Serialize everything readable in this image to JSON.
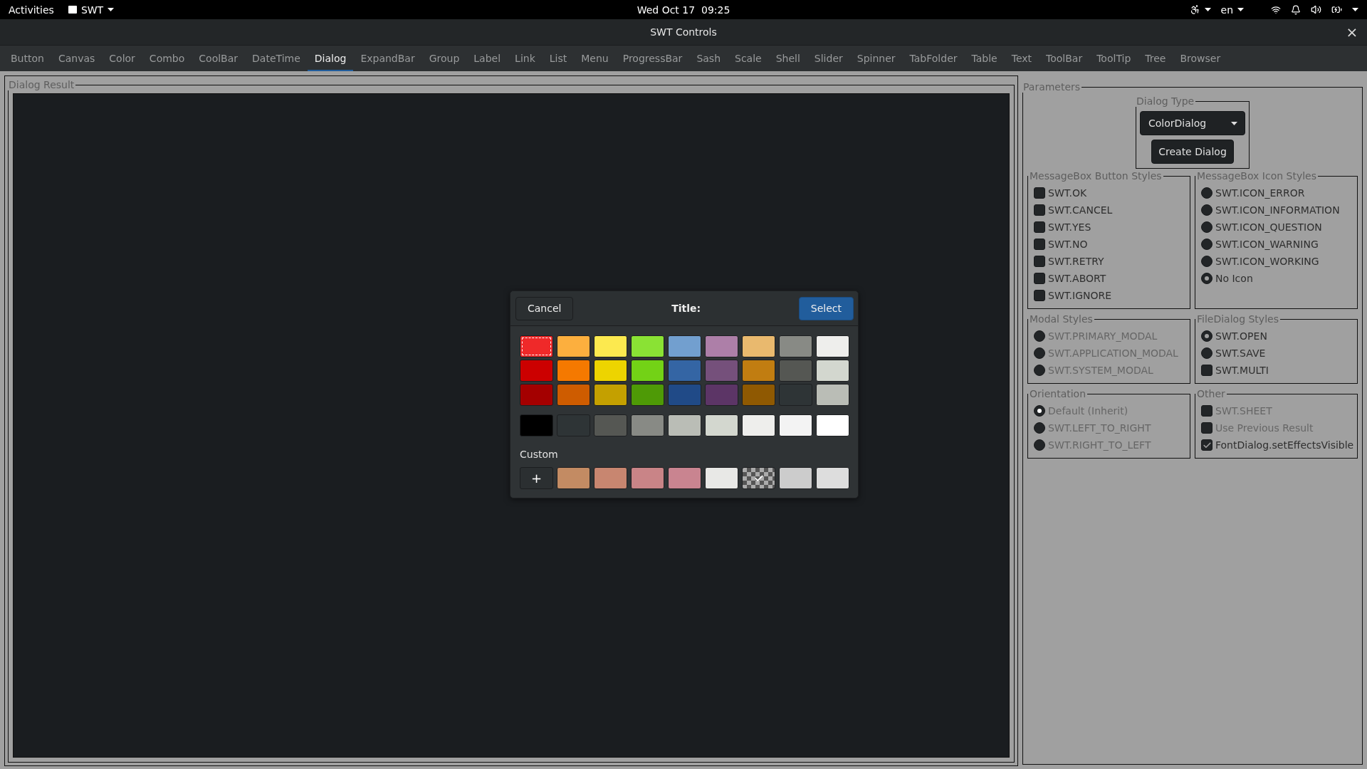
{
  "top_bar": {
    "activities": "Activities",
    "app_menu": "SWT",
    "clock": "Wed Oct 17  09:25",
    "language": "en"
  },
  "window": {
    "title": "SWT Controls",
    "close": "×"
  },
  "tabs": [
    {
      "label": "Button",
      "selected": false
    },
    {
      "label": "Canvas",
      "selected": false
    },
    {
      "label": "Color",
      "selected": false
    },
    {
      "label": "Combo",
      "selected": false
    },
    {
      "label": "CoolBar",
      "selected": false
    },
    {
      "label": "DateTime",
      "selected": false
    },
    {
      "label": "Dialog",
      "selected": true
    },
    {
      "label": "ExpandBar",
      "selected": false
    },
    {
      "label": "Group",
      "selected": false
    },
    {
      "label": "Label",
      "selected": false
    },
    {
      "label": "Link",
      "selected": false
    },
    {
      "label": "List",
      "selected": false
    },
    {
      "label": "Menu",
      "selected": false
    },
    {
      "label": "ProgressBar",
      "selected": false
    },
    {
      "label": "Sash",
      "selected": false
    },
    {
      "label": "Scale",
      "selected": false
    },
    {
      "label": "Shell",
      "selected": false
    },
    {
      "label": "Slider",
      "selected": false
    },
    {
      "label": "Spinner",
      "selected": false
    },
    {
      "label": "TabFolder",
      "selected": false
    },
    {
      "label": "Table",
      "selected": false
    },
    {
      "label": "Text",
      "selected": false
    },
    {
      "label": "ToolBar",
      "selected": false
    },
    {
      "label": "ToolTip",
      "selected": false
    },
    {
      "label": "Tree",
      "selected": false
    },
    {
      "label": "Browser",
      "selected": false
    }
  ],
  "result_group": {
    "legend": "Dialog Result"
  },
  "parameters": {
    "legend": "Parameters",
    "dialog_type": {
      "legend": "Dialog Type",
      "value": "ColorDialog",
      "button": "Create Dialog"
    },
    "groups": [
      {
        "legend": "MessageBox Button Styles",
        "items": [
          {
            "label": "SWT.OK",
            "kind": "checkbox",
            "checked": false,
            "disabled": false
          },
          {
            "label": "SWT.CANCEL",
            "kind": "checkbox",
            "checked": false,
            "disabled": false
          },
          {
            "label": "SWT.YES",
            "kind": "checkbox",
            "checked": false,
            "disabled": false
          },
          {
            "label": "SWT.NO",
            "kind": "checkbox",
            "checked": false,
            "disabled": false
          },
          {
            "label": "SWT.RETRY",
            "kind": "checkbox",
            "checked": false,
            "disabled": false
          },
          {
            "label": "SWT.ABORT",
            "kind": "checkbox",
            "checked": false,
            "disabled": false
          },
          {
            "label": "SWT.IGNORE",
            "kind": "checkbox",
            "checked": false,
            "disabled": false
          }
        ]
      },
      {
        "legend": "MessageBox Icon Styles",
        "items": [
          {
            "label": "SWT.ICON_ERROR",
            "kind": "radio",
            "checked": false,
            "disabled": false
          },
          {
            "label": "SWT.ICON_INFORMATION",
            "kind": "radio",
            "checked": false,
            "disabled": false
          },
          {
            "label": "SWT.ICON_QUESTION",
            "kind": "radio",
            "checked": false,
            "disabled": false
          },
          {
            "label": "SWT.ICON_WARNING",
            "kind": "radio",
            "checked": false,
            "disabled": false
          },
          {
            "label": "SWT.ICON_WORKING",
            "kind": "radio",
            "checked": false,
            "disabled": false
          },
          {
            "label": "No Icon",
            "kind": "radio",
            "checked": true,
            "disabled": false
          }
        ]
      },
      {
        "legend": "Modal Styles",
        "items": [
          {
            "label": "SWT.PRIMARY_MODAL",
            "kind": "radio",
            "checked": false,
            "disabled": true
          },
          {
            "label": "SWT.APPLICATION_MODAL",
            "kind": "radio",
            "checked": false,
            "disabled": true
          },
          {
            "label": "SWT.SYSTEM_MODAL",
            "kind": "radio",
            "checked": false,
            "disabled": true
          }
        ]
      },
      {
        "legend": "FileDialog Styles",
        "items": [
          {
            "label": "SWT.OPEN",
            "kind": "radio",
            "checked": true,
            "disabled": false
          },
          {
            "label": "SWT.SAVE",
            "kind": "radio",
            "checked": false,
            "disabled": false
          },
          {
            "label": "SWT.MULTI",
            "kind": "checkbox",
            "checked": false,
            "disabled": false
          }
        ]
      },
      {
        "legend": "Orientation",
        "items": [
          {
            "label": "Default (Inherit)",
            "kind": "radio",
            "checked": true,
            "disabled": true
          },
          {
            "label": "SWT.LEFT_TO_RIGHT",
            "kind": "radio",
            "checked": false,
            "disabled": true
          },
          {
            "label": "SWT.RIGHT_TO_LEFT",
            "kind": "radio",
            "checked": false,
            "disabled": true
          }
        ]
      },
      {
        "legend": "Other",
        "items": [
          {
            "label": "SWT.SHEET",
            "kind": "checkbox",
            "checked": false,
            "disabled": true
          },
          {
            "label": "Use Previous Result",
            "kind": "checkbox",
            "checked": false,
            "disabled": true
          },
          {
            "label": "FontDialog.setEffectsVisible",
            "kind": "checkbox",
            "checked": true,
            "disabled": false
          }
        ]
      }
    ]
  },
  "color_dialog": {
    "cancel": "Cancel",
    "title": "Title:",
    "select": "Select",
    "palette": [
      [
        {
          "color": "#ef2929",
          "selected": true
        },
        {
          "color": "#fcaf3e",
          "selected": false
        },
        {
          "color": "#fce94f",
          "selected": false
        },
        {
          "color": "#8ae234",
          "selected": false
        },
        {
          "color": "#729fcf",
          "selected": false
        },
        {
          "color": "#ad7fa8",
          "selected": false
        },
        {
          "color": "#e9b96e",
          "selected": false
        },
        {
          "color": "#888a85",
          "selected": false
        },
        {
          "color": "#eeeeec",
          "selected": false
        }
      ],
      [
        {
          "color": "#cc0000",
          "selected": false
        },
        {
          "color": "#f57900",
          "selected": false
        },
        {
          "color": "#edd400",
          "selected": false
        },
        {
          "color": "#73d216",
          "selected": false
        },
        {
          "color": "#3465a4",
          "selected": false
        },
        {
          "color": "#75507b",
          "selected": false
        },
        {
          "color": "#c17d11",
          "selected": false
        },
        {
          "color": "#555753",
          "selected": false
        },
        {
          "color": "#d3d7cf",
          "selected": false
        }
      ],
      [
        {
          "color": "#a40000",
          "selected": false
        },
        {
          "color": "#ce5c00",
          "selected": false
        },
        {
          "color": "#c4a000",
          "selected": false
        },
        {
          "color": "#4e9a06",
          "selected": false
        },
        {
          "color": "#204a87",
          "selected": false
        },
        {
          "color": "#5c3566",
          "selected": false
        },
        {
          "color": "#8f5902",
          "selected": false
        },
        {
          "color": "#2e3436",
          "selected": false
        },
        {
          "color": "#babdb6",
          "selected": false
        }
      ]
    ],
    "greys": [
      {
        "color": "#000000"
      },
      {
        "color": "#2e3436"
      },
      {
        "color": "#555753"
      },
      {
        "color": "#888a85"
      },
      {
        "color": "#babdb6"
      },
      {
        "color": "#d3d7cf"
      },
      {
        "color": "#eeeeec"
      },
      {
        "color": "#f3f3f3"
      },
      {
        "color": "#ffffff"
      }
    ],
    "custom_label": "Custom",
    "custom": [
      {
        "kind": "add",
        "label": "+"
      },
      {
        "kind": "color",
        "color": "#c38b63",
        "selected": false
      },
      {
        "kind": "color",
        "color": "#c88670",
        "selected": false
      },
      {
        "kind": "color",
        "color": "#c98487",
        "selected": false
      },
      {
        "kind": "color",
        "color": "#c98490",
        "selected": false
      },
      {
        "kind": "color",
        "color": "#e8e8e6",
        "selected": false
      },
      {
        "kind": "transparent",
        "selected": true
      },
      {
        "kind": "color",
        "color": "#cccccc",
        "selected": false
      },
      {
        "kind": "color",
        "color": "#dddddd",
        "selected": false
      }
    ]
  }
}
